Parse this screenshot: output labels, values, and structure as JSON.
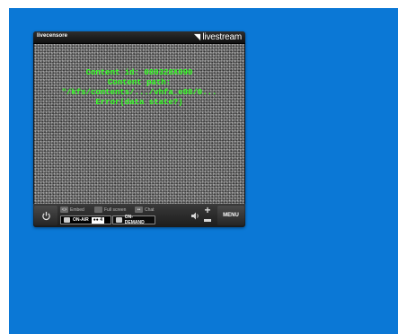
{
  "player": {
    "channel_name": "livecensore",
    "brand": "livestream",
    "message_lines": [
      "Content id: 080328X090",
      "Content path: \"/kfs/contents/.../vhfa_e08/0...",
      "Error(data state?)"
    ]
  },
  "controls": {
    "embed_label": "Embed",
    "fullscreen_label": "Full screen",
    "chat_label": "Chat",
    "on_air_label": "ON-AIR",
    "viewers": "4",
    "on_demand_label": "ON-DEMAND",
    "menu_label": "MENU"
  },
  "colors": {
    "page_background": "#0b78d6",
    "message_text": "#33ff22"
  }
}
